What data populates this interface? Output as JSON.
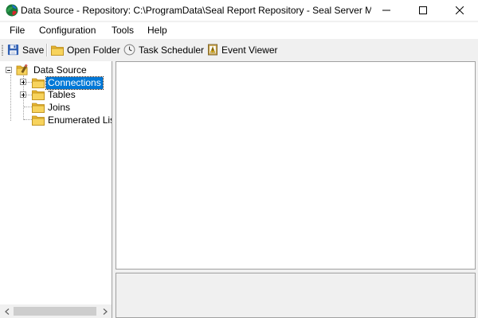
{
  "window": {
    "title": "Data Source - Repository: C:\\ProgramData\\Seal Report Repository - Seal Server Man..."
  },
  "menu": {
    "items": [
      {
        "label": "File"
      },
      {
        "label": "Configuration"
      },
      {
        "label": "Tools"
      },
      {
        "label": "Help"
      }
    ]
  },
  "toolbar": {
    "save_label": "Save",
    "open_folder_label": "Open Folder",
    "task_scheduler_label": "Task Scheduler",
    "event_viewer_label": "Event Viewer"
  },
  "tree": {
    "root": {
      "label": "Data Source"
    },
    "children": [
      {
        "label": "Connections",
        "expandable": true,
        "selected": true
      },
      {
        "label": "Tables",
        "expandable": true,
        "selected": false
      },
      {
        "label": "Joins",
        "expandable": false,
        "selected": false
      },
      {
        "label": "Enumerated Lists",
        "expandable": false,
        "selected": false
      }
    ]
  },
  "colors": {
    "selection": "#0078d7",
    "folder": "#f5c542",
    "chrome": "#f0f0f0"
  },
  "icons": {
    "app": "seal-globe-icon",
    "save": "floppy-disk-icon",
    "open_folder": "folder-icon",
    "task_scheduler": "clock-icon",
    "event_viewer": "event-log-icon"
  }
}
